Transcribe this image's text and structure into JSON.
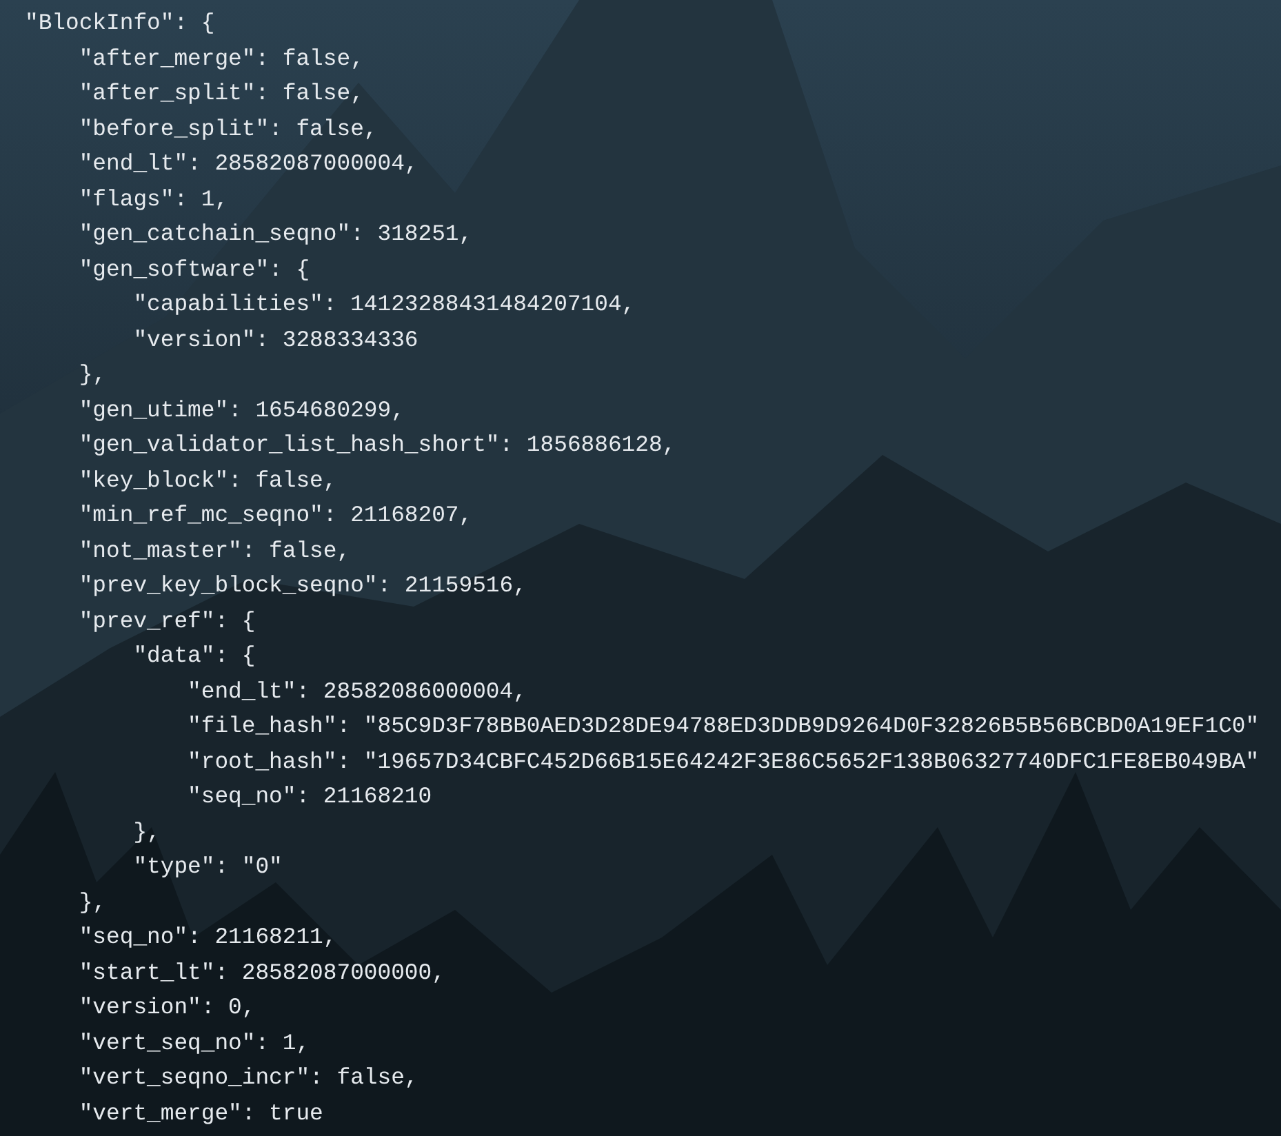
{
  "terminal": {
    "lines": [
      {
        "text": "\"BlockInfo\": {",
        "children": [
          {
            "text": "\"after_merge\": false,"
          },
          {
            "text": "\"after_split\": false,"
          },
          {
            "text": "\"before_split\": false,"
          },
          {
            "text": "\"end_lt\": 28582087000004,"
          },
          {
            "text": "\"flags\": 1,"
          },
          {
            "text": "\"gen_catchain_seqno\": 318251,"
          },
          {
            "text": "\"gen_software\": {",
            "children": [
              {
                "text": "\"capabilities\": 14123288431484207104,"
              },
              {
                "text": "\"version\": 3288334336"
              }
            ]
          },
          {
            "text": "},"
          },
          {
            "text": "\"gen_utime\": 1654680299,"
          },
          {
            "text": "\"gen_validator_list_hash_short\": 1856886128,"
          },
          {
            "text": "\"key_block\": false,"
          },
          {
            "text": "\"min_ref_mc_seqno\": 21168207,"
          },
          {
            "text": "\"not_master\": false,"
          },
          {
            "text": "\"prev_key_block_seqno\": 21159516,"
          },
          {
            "text": "\"prev_ref\": {",
            "children": [
              {
                "text": "\"data\": {",
                "children": [
                  {
                    "text": "\"end_lt\": 28582086000004,"
                  },
                  {
                    "text": "\"file_hash\": \"85C9D3F78BB0AED3D28DE94788ED3DDB9D9264D0F32826B5B56BCBD0A19EF1C0\""
                  },
                  {
                    "text": "\"root_hash\": \"19657D34CBFC452D66B15E64242F3E86C5652F138B06327740DFC1FE8EB049BA\""
                  },
                  {
                    "text": "\"seq_no\": 21168210"
                  }
                ]
              },
              {
                "text": "},"
              },
              {
                "text": "\"type\": \"0\""
              }
            ]
          },
          {
            "text": "},"
          },
          {
            "text": "\"seq_no\": 21168211,"
          },
          {
            "text": "\"start_lt\": 28582087000000,"
          },
          {
            "text": "\"version\": 0,"
          },
          {
            "text": "\"vert_seq_no\": 1,"
          },
          {
            "text": "\"vert_seqno_incr\": false,"
          },
          {
            "text": "\"vert_merge\": true"
          }
        ]
      }
    ]
  }
}
